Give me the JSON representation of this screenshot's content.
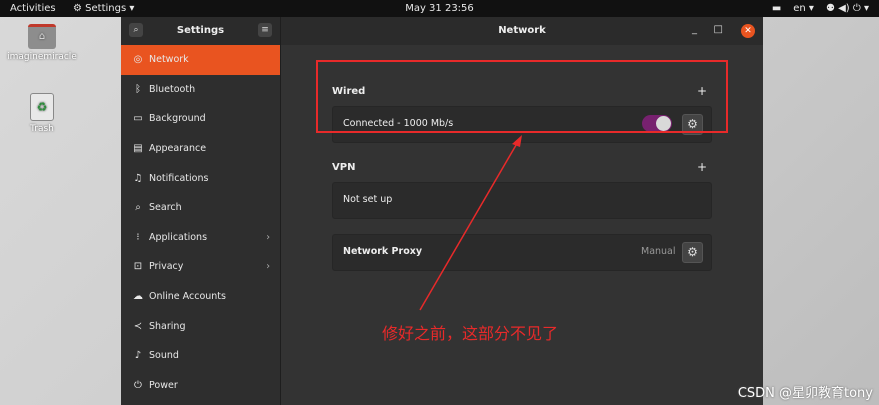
{
  "topbar": {
    "activities": "Activities",
    "app_menu": "Settings ▾",
    "clock": "May 31  23:56",
    "lang": "en ▾",
    "system_icons": "⚉  ◀)  ⏻ ▾"
  },
  "desktop": {
    "home_label": "imaginemiracle",
    "trash_label": "Trash"
  },
  "window": {
    "sidebar_title": "Settings",
    "main_title": "Network",
    "minimize": "_",
    "maximize": "□",
    "close": "✕"
  },
  "sidebar": {
    "items": [
      {
        "label": "Network",
        "icon": "◎"
      },
      {
        "label": "Bluetooth",
        "icon": "ᛒ"
      },
      {
        "label": "Background",
        "icon": "▭"
      },
      {
        "label": "Appearance",
        "icon": "▤"
      },
      {
        "label": "Notifications",
        "icon": "♫"
      },
      {
        "label": "Search",
        "icon": "⌕"
      },
      {
        "label": "Applications",
        "icon": "⁝"
      },
      {
        "label": "Privacy",
        "icon": "⊡"
      },
      {
        "label": "Online Accounts",
        "icon": "☁"
      },
      {
        "label": "Sharing",
        "icon": "≺"
      },
      {
        "label": "Sound",
        "icon": "♪"
      },
      {
        "label": "Power",
        "icon": "⏻"
      }
    ]
  },
  "network": {
    "wired_title": "Wired",
    "wired_status": "Connected - 1000 Mb/s",
    "wired_enabled": true,
    "vpn_title": "VPN",
    "vpn_status": "Not set up",
    "proxy_title": "Network Proxy",
    "proxy_mode": "Manual",
    "add_symbol": "+"
  },
  "annotation": {
    "text": "修好之前，这部分不见了",
    "color": "#e82a2a"
  },
  "watermark": "CSDN @星卯教育tony",
  "colors": {
    "accent": "#e95420",
    "toggle_on": "#77216f"
  }
}
